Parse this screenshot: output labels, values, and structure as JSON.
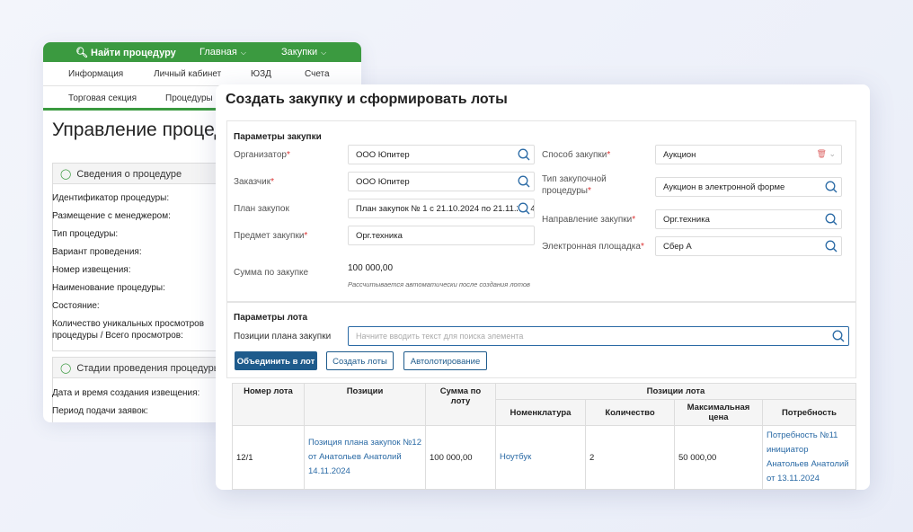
{
  "back": {
    "nav1": [
      "Найти процедуру",
      "Главная",
      "Закупки"
    ],
    "nav2": [
      "Информация",
      "Личный кабинет",
      "ЮЗД",
      "Счета"
    ],
    "nav3": [
      "Торговая секция",
      "Процедуры"
    ],
    "title": "Управление процедурой",
    "section1": "Сведения о процедуре",
    "fields": [
      "Идентификатор процедуры:",
      "Размещение с менеджером:",
      "Тип процедуры:",
      "Вариант проведения:",
      "Номер извещения:",
      "Наименование процедуры:",
      "Состояние:",
      "Количество уникальных просмотров процедуры / Всего просмотров:"
    ],
    "section2": "Стадии проведения процедуры",
    "fields2": [
      "Дата и время создания извещения:",
      "Период подачи заявок:"
    ]
  },
  "front": {
    "title": "Создать закупку и сформировать лоты",
    "params_title": "Параметры закупки",
    "organizer": {
      "label": "Организатор",
      "value": "ООО Юпитер"
    },
    "customer": {
      "label": "Заказчик",
      "value": "ООО Юпитер"
    },
    "plan": {
      "label": "План закупок",
      "value": "План закупок № 1 с 21.10.2024 по 21.11.2024"
    },
    "subject": {
      "label": "Предмет закупки",
      "value": "Орг.техника"
    },
    "sum": {
      "label": "Сумма по закупке",
      "value": "100 000,00",
      "note": "Рассчитывается автоматически после создания лотов"
    },
    "method": {
      "label": "Способ закупки",
      "value": "Аукцион"
    },
    "proc_type": {
      "label": "Тип закупочной процедуры",
      "value": "Аукцион в электронной форме"
    },
    "direction": {
      "label": "Направление закупки",
      "value": "Орг.техника"
    },
    "platform": {
      "label": "Электронная площадка",
      "value": "Сбер А"
    },
    "lot_title": "Параметры лота",
    "positions": {
      "label": "Позиции плана закупки",
      "placeholder": "Начните вводить текст для поиска элемента"
    },
    "buttons": {
      "merge": "Объединить в лот",
      "create": "Создать лоты",
      "auto": "Автолотирование"
    },
    "table": {
      "headers": [
        "Номер лота",
        "Позиции",
        "Сумма по лоту",
        "Позиции лота"
      ],
      "subheaders": [
        "Номенклатура",
        "Количество",
        "Максимальная цена",
        "Потребность"
      ],
      "rows": [
        {
          "lot": "12/1",
          "position": "Позиция плана закупок №12 от Анатольев Анатолий 14.11.2024",
          "sum": "100 000,00",
          "nomenclature": "Ноутбук",
          "qty": "2",
          "max_price": "50 000,00",
          "need": "Потребность №11 инициатор Анатольев Анатолий от 13.11.2024"
        }
      ]
    }
  },
  "colors": {
    "green": "#3b9a40",
    "primary": "#1e5b8c",
    "link": "#2a6aa5",
    "required": "#dd3333"
  }
}
